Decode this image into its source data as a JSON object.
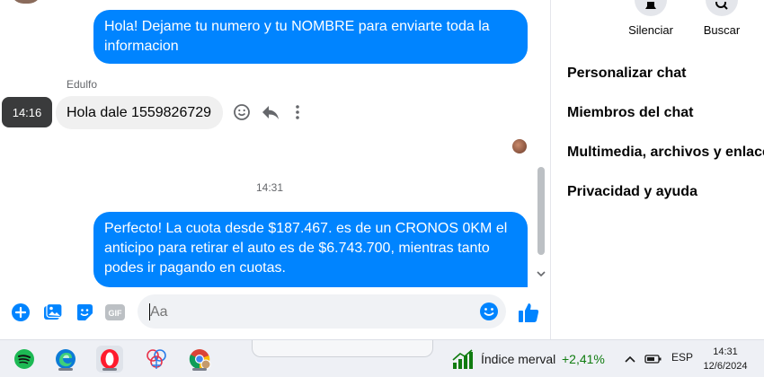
{
  "messages": {
    "outgoing_1": "Hola! Dejame tu numero y tu NOMBRE para enviarte toda la informacion",
    "incoming_sender": "Edulfo",
    "incoming_1": "Hola dale 1559826729",
    "incoming_1_time": "14:16",
    "separator_time": "14:31",
    "outgoing_2": "Perfecto! La cuota desde $187.467. es de un CRONOS 0KM el anticipo para retirar el auto es de $6.743.700, mientras tanto podes ir pagando en cuotas."
  },
  "composer": {
    "placeholder": "Aa"
  },
  "sidebar": {
    "actions": [
      {
        "label": "Silenciar",
        "icon": "bell-icon"
      },
      {
        "label": "Buscar",
        "icon": "search-icon"
      }
    ],
    "menu": [
      {
        "label": "Personalizar chat"
      },
      {
        "label": "Miembros del chat"
      },
      {
        "label": "Multimedia, archivos y enlaces"
      },
      {
        "label": "Privacidad y ayuda"
      }
    ]
  },
  "taskbar": {
    "apps": [
      "spotify-icon",
      "edge-icon",
      "opera-icon",
      "app-icon",
      "chrome-icon"
    ],
    "widget_label": "Índice merval",
    "widget_value": "+2,41%",
    "language": "ESP",
    "time": "14:31",
    "date": "12/6/2024"
  },
  "colors": {
    "accent": "#0084ff",
    "up": "#107c10"
  }
}
